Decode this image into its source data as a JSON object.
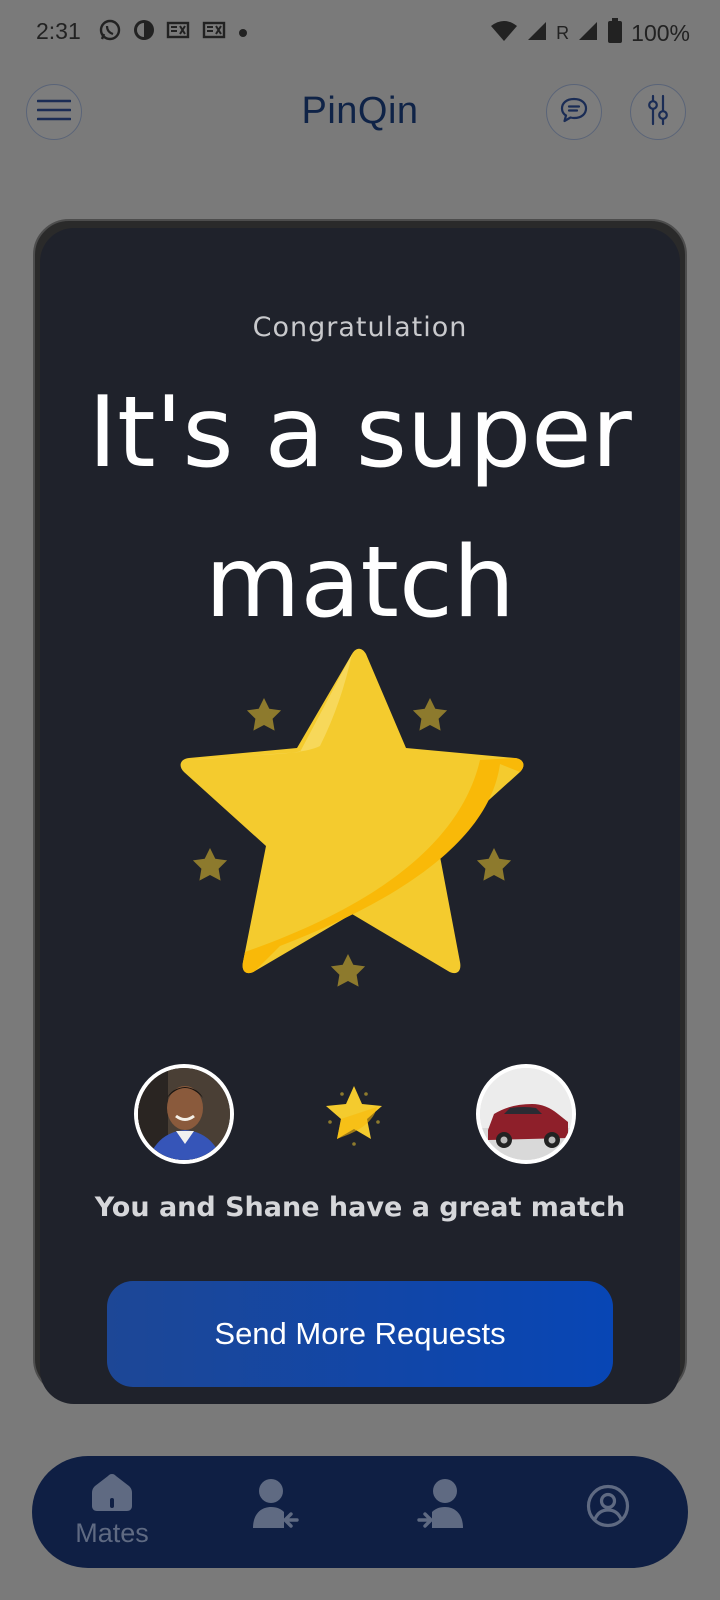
{
  "status_bar": {
    "time": "2:31",
    "battery": "100%",
    "network_label": "R"
  },
  "header": {
    "title": "PinQin",
    "menu_icon": "hamburger-menu-icon",
    "chat_icon": "chat-bubble-icon",
    "filter_icon": "sliders-filter-icon"
  },
  "match_card": {
    "eyebrow": "Congratulation",
    "headline_line1": "It's a super",
    "headline_line2": "match",
    "match_message": "You and Shane have a great match",
    "send_button_label": "Send More Requests"
  },
  "bottom_nav": {
    "items": [
      {
        "label": "Mates",
        "icon": "home-icon",
        "active": true
      },
      {
        "label": "",
        "icon": "incoming-requests-icon",
        "active": false
      },
      {
        "label": "",
        "icon": "outgoing-requests-icon",
        "active": false
      },
      {
        "label": "",
        "icon": "profile-icon",
        "active": false
      }
    ]
  },
  "colors": {
    "accent": "#0846b5",
    "card_background": "#1f222b",
    "star_gold": "#f4cb2e",
    "nav_background": "#0f1f44"
  }
}
